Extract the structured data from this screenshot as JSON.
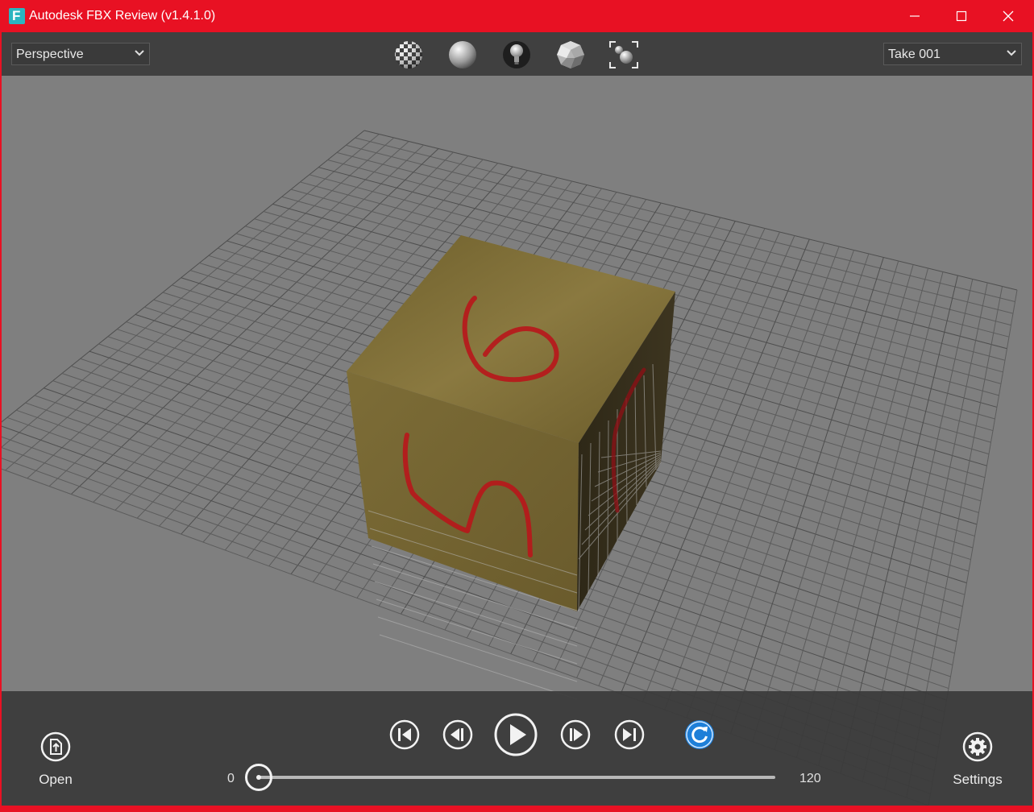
{
  "window": {
    "title": "Autodesk FBX Review (v1.4.1.0)",
    "app_icon_letter": "F",
    "controls": [
      "minimize",
      "maximize",
      "close"
    ],
    "accent_color": "#e81123"
  },
  "toolbar": {
    "camera_select": {
      "value": "Perspective",
      "options_visible": [
        "Perspective"
      ]
    },
    "take_select": {
      "value": "Take 001",
      "options_visible": [
        "Take 001"
      ]
    },
    "tools": [
      {
        "name": "texture-display-icon"
      },
      {
        "name": "shading-icon"
      },
      {
        "name": "lighting-icon"
      },
      {
        "name": "wireframe-icon"
      },
      {
        "name": "frame-all-icon"
      }
    ]
  },
  "viewport": {
    "background_color": "#7f7f7f",
    "grid_color": "#5a5a5a",
    "cube_color": "#7a6a35",
    "marking_color": "#c0161c",
    "top_face_marking": "6",
    "front_face_marking": "5",
    "right_face_marking": "1"
  },
  "playback": {
    "open_label": "Open",
    "settings_label": "Settings",
    "timeline_start": "0",
    "timeline_end": "120",
    "current_frame_fraction": 0.0,
    "loop_color": "#1e7fd8"
  }
}
